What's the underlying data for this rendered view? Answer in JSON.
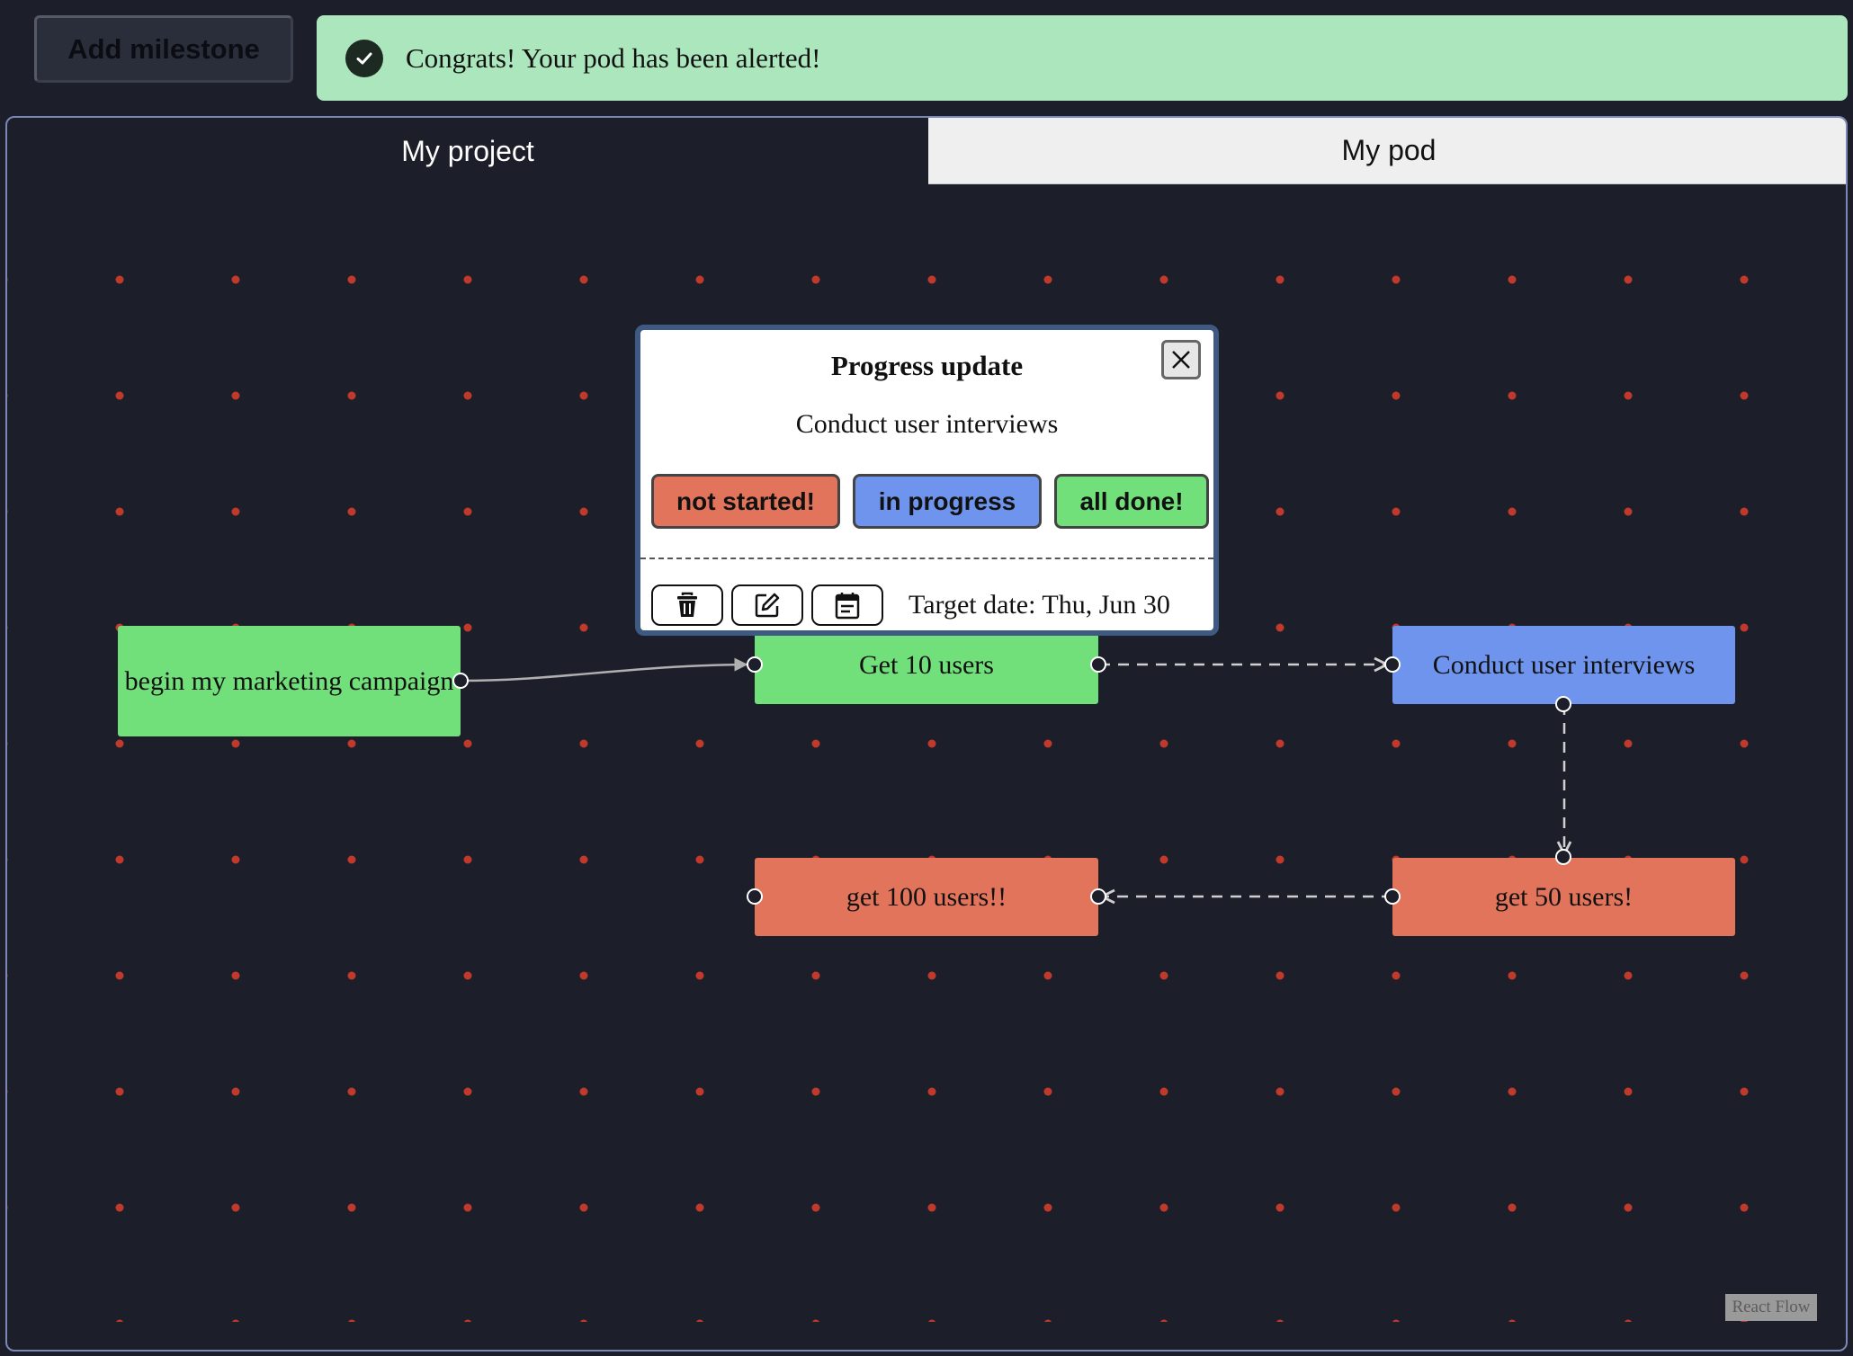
{
  "toolbar": {
    "add_milestone_label": "Add milestone"
  },
  "toast": {
    "icon": "check-circle-icon",
    "message": "Congrats! Your pod has been alerted!",
    "color": "#abe6bd"
  },
  "tabs": [
    {
      "label": "My project",
      "active": true
    },
    {
      "label": "My pod",
      "active": false
    }
  ],
  "status_colors": {
    "not_started": "#e2745b",
    "in_progress": "#6e94ee",
    "done": "#72e07a",
    "background_dots": "#c0392b"
  },
  "nodes": [
    {
      "id": "marketing",
      "label": "begin my marketing campaign",
      "status": "done"
    },
    {
      "id": "get10",
      "label": "Get 10 users",
      "status": "done"
    },
    {
      "id": "interviews",
      "label": "Conduct user interviews",
      "status": "in_progress"
    },
    {
      "id": "get50",
      "label": "get 50 users!",
      "status": "not_started"
    },
    {
      "id": "get100",
      "label": "get 100 users!!",
      "status": "not_started"
    }
  ],
  "edges": [
    {
      "from": "marketing",
      "to": "get10",
      "style": "solid"
    },
    {
      "from": "get10",
      "to": "interviews",
      "style": "dashed"
    },
    {
      "from": "interviews",
      "to": "get50",
      "style": "dashed"
    },
    {
      "from": "get50",
      "to": "get100",
      "style": "dashed"
    }
  ],
  "modal": {
    "title": "Progress update",
    "milestone": "Conduct user interviews",
    "status_buttons": [
      "not started!",
      "in progress",
      "all done!"
    ],
    "tools": [
      "trash-icon",
      "edit-icon",
      "calendar-icon"
    ],
    "target_date": "Target date: Thu, Jun 30"
  },
  "attribution": "React Flow"
}
